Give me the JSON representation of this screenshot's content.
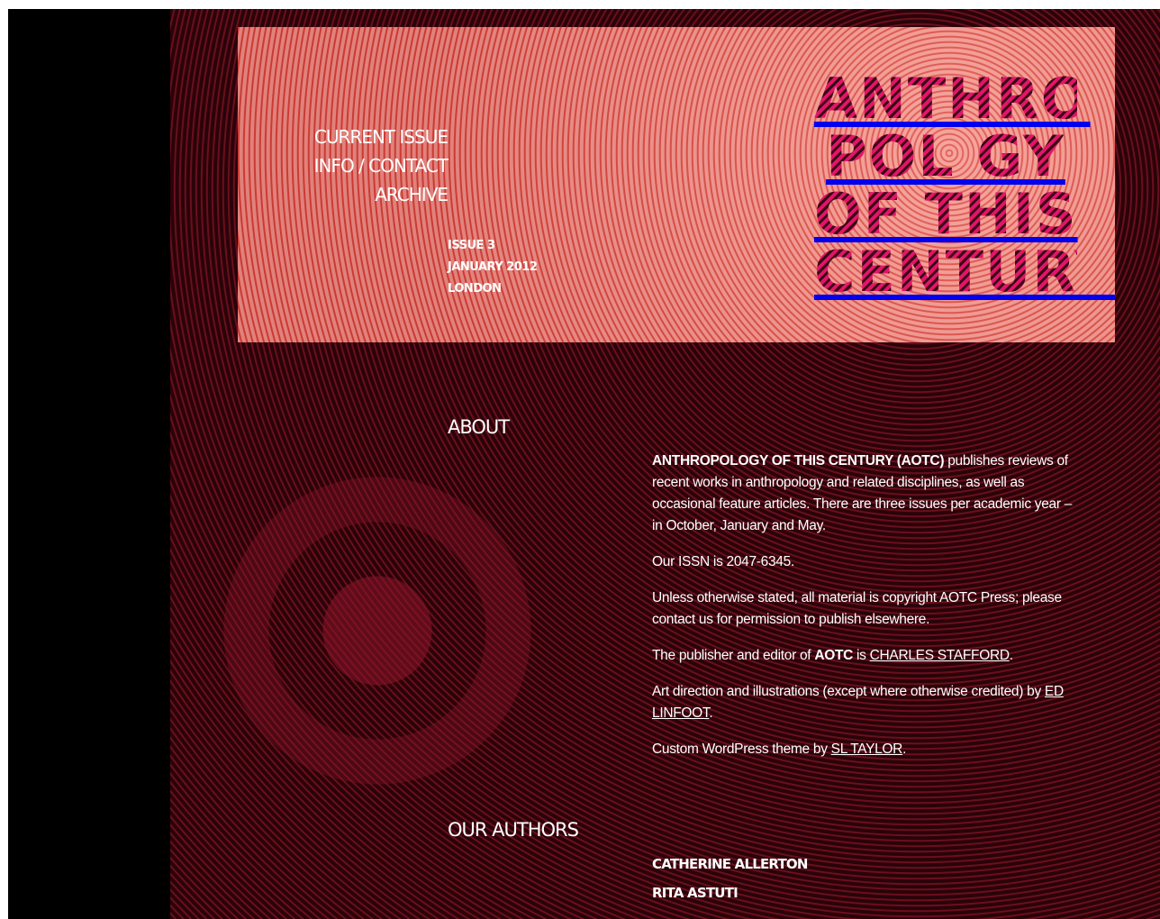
{
  "nav": {
    "current_issue": "CURRENT ISSUE",
    "info_contact": "INFO / CONTACT",
    "archive": "ARCHIVE"
  },
  "issue": {
    "number": "ISSUE 3",
    "date": "JANUARY 2012",
    "place": "LONDON"
  },
  "logo": {
    "line1": "ANTHRO",
    "line2": "POL  GY",
    "line3": "OF THIS",
    "line4": "CENTURY"
  },
  "about": {
    "heading": "ABOUT",
    "p1_bold": "ANTHROPOLOGY OF THIS CENTURY (AOTC)",
    "p1_rest": " publishes reviews of recent works in anthropology and related disciplines, as well as occasional feature articles. There are three issues per academic year – in October, January and May.",
    "p2": "Our ISSN is 2047-6345.",
    "p3": "Unless otherwise stated, all material is copyright AOTC Press; please contact us for permission to publish elsewhere.",
    "p4_pre": "The publisher and editor of ",
    "p4_bold": "AOTC",
    "p4_mid": " is ",
    "p4_link": "CHARLES STAFFORD",
    "p4_end": ".",
    "p5_pre": "Art direction and illustrations (except where otherwise credited) by ",
    "p5_link": "ED LINFOOT",
    "p5_end": ".",
    "p6_pre": "Custom WordPress theme by ",
    "p6_link": "SL TAYLOR",
    "p6_end": "."
  },
  "authors": {
    "heading": "OUR AUTHORS",
    "items": [
      "CATHERINE ALLERTON",
      "RITA ASTUTI"
    ]
  },
  "colors": {
    "header_light": "#f39790",
    "header_dark": "#d9423a",
    "logo_pink": "#e0156a",
    "background_dark": "#1a0205",
    "ring_red": "#6a0f1d"
  }
}
